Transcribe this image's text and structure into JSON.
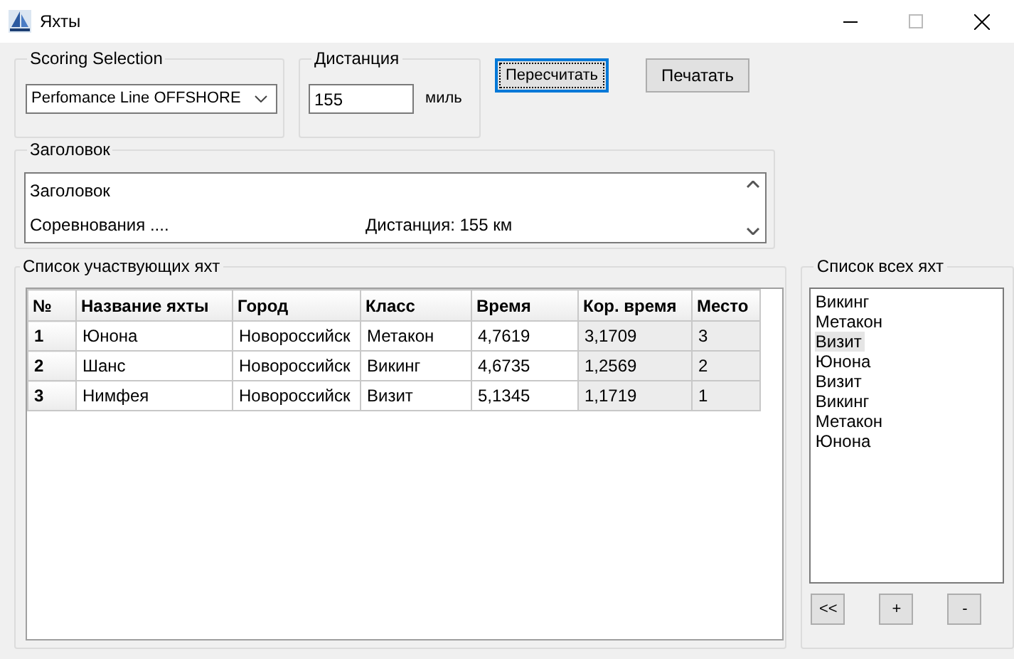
{
  "window": {
    "title": "Яхты"
  },
  "scoring": {
    "legend": "Scoring Selection",
    "value": "Perfomance Line OFFSHORE"
  },
  "distance": {
    "legend": "Дистанция",
    "value": "155",
    "unit": "миль"
  },
  "buttons": [
    {
      "label": "Пересчитать",
      "focused": true
    },
    {
      "label": "Печатать",
      "focused": false
    }
  ],
  "header": {
    "legend": "Заголовок",
    "lines": [
      {
        "left": "Заголовок"
      },
      {
        "left": "Соревнования ....",
        "right": "Дистанция: 155 км"
      }
    ]
  },
  "participants": {
    "legend": "Список участвующих яхт",
    "columns": [
      "№",
      "Название яхты",
      "Город",
      "Класс",
      "Время",
      "Кор. время",
      "Место"
    ],
    "rows": [
      [
        "1",
        "Юнона",
        "Новороссийск",
        "Метакон",
        "4,7619",
        "3,1709",
        "3"
      ],
      [
        "2",
        "Шанс",
        "Новороссийск",
        "Викинг",
        "4,6735",
        "1,2569",
        "2"
      ],
      [
        "3",
        "Нимфея",
        "Новороссийск",
        "Визит",
        "5,1345",
        "1,1719",
        "1"
      ]
    ]
  },
  "all_yachts": {
    "legend": "Список всех яхт",
    "items": [
      {
        "label": "Викинг",
        "selected": false
      },
      {
        "label": "Метакон",
        "selected": false
      },
      {
        "label": "Визит",
        "selected": true
      },
      {
        "label": "Юнона",
        "selected": false
      },
      {
        "label": "Визит",
        "selected": false
      },
      {
        "label": "Викинг",
        "selected": false
      },
      {
        "label": "Метакон",
        "selected": false
      },
      {
        "label": "Юнона",
        "selected": false
      }
    ],
    "buttons": [
      "<<",
      "+",
      "-"
    ]
  }
}
